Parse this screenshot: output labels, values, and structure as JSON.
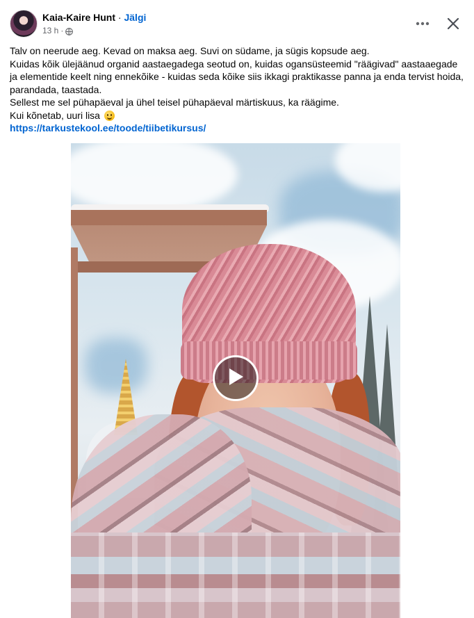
{
  "post": {
    "author": "Kaia-Kaire Hunt",
    "separator": "·",
    "follow_label": "Jälgi",
    "time": "13 h",
    "time_separator": "·",
    "privacy_icon": "globe-icon",
    "more_icon": "more-options-icon",
    "close_icon": "close-icon"
  },
  "content": {
    "line1": "Talv on neerude aeg. Kevad on maksa aeg. Suvi on südame, ja sügis kopsude aeg.",
    "line2": "Kuidas kõik ülejäänud organid aastaegadega seotud on, kuidas ogansüsteemid \"räägivad\" aastaaegade ja elementide keelt ning ennekõike - kuidas seda kõike siis ikkagi praktikasse panna ja enda tervist hoida, parandada, taastada.",
    "line3": "Sellest me sel pühapäeval ja ühel teisel pühapäeval märtiskuus, ka räägime.",
    "line4": "Kui kõnetab, uuri lisa",
    "emoji": "smiling-face-emoji",
    "link": "https://tarkustekool.ee/toode/tiibetikursus/"
  },
  "video": {
    "play_icon": "play-icon"
  }
}
